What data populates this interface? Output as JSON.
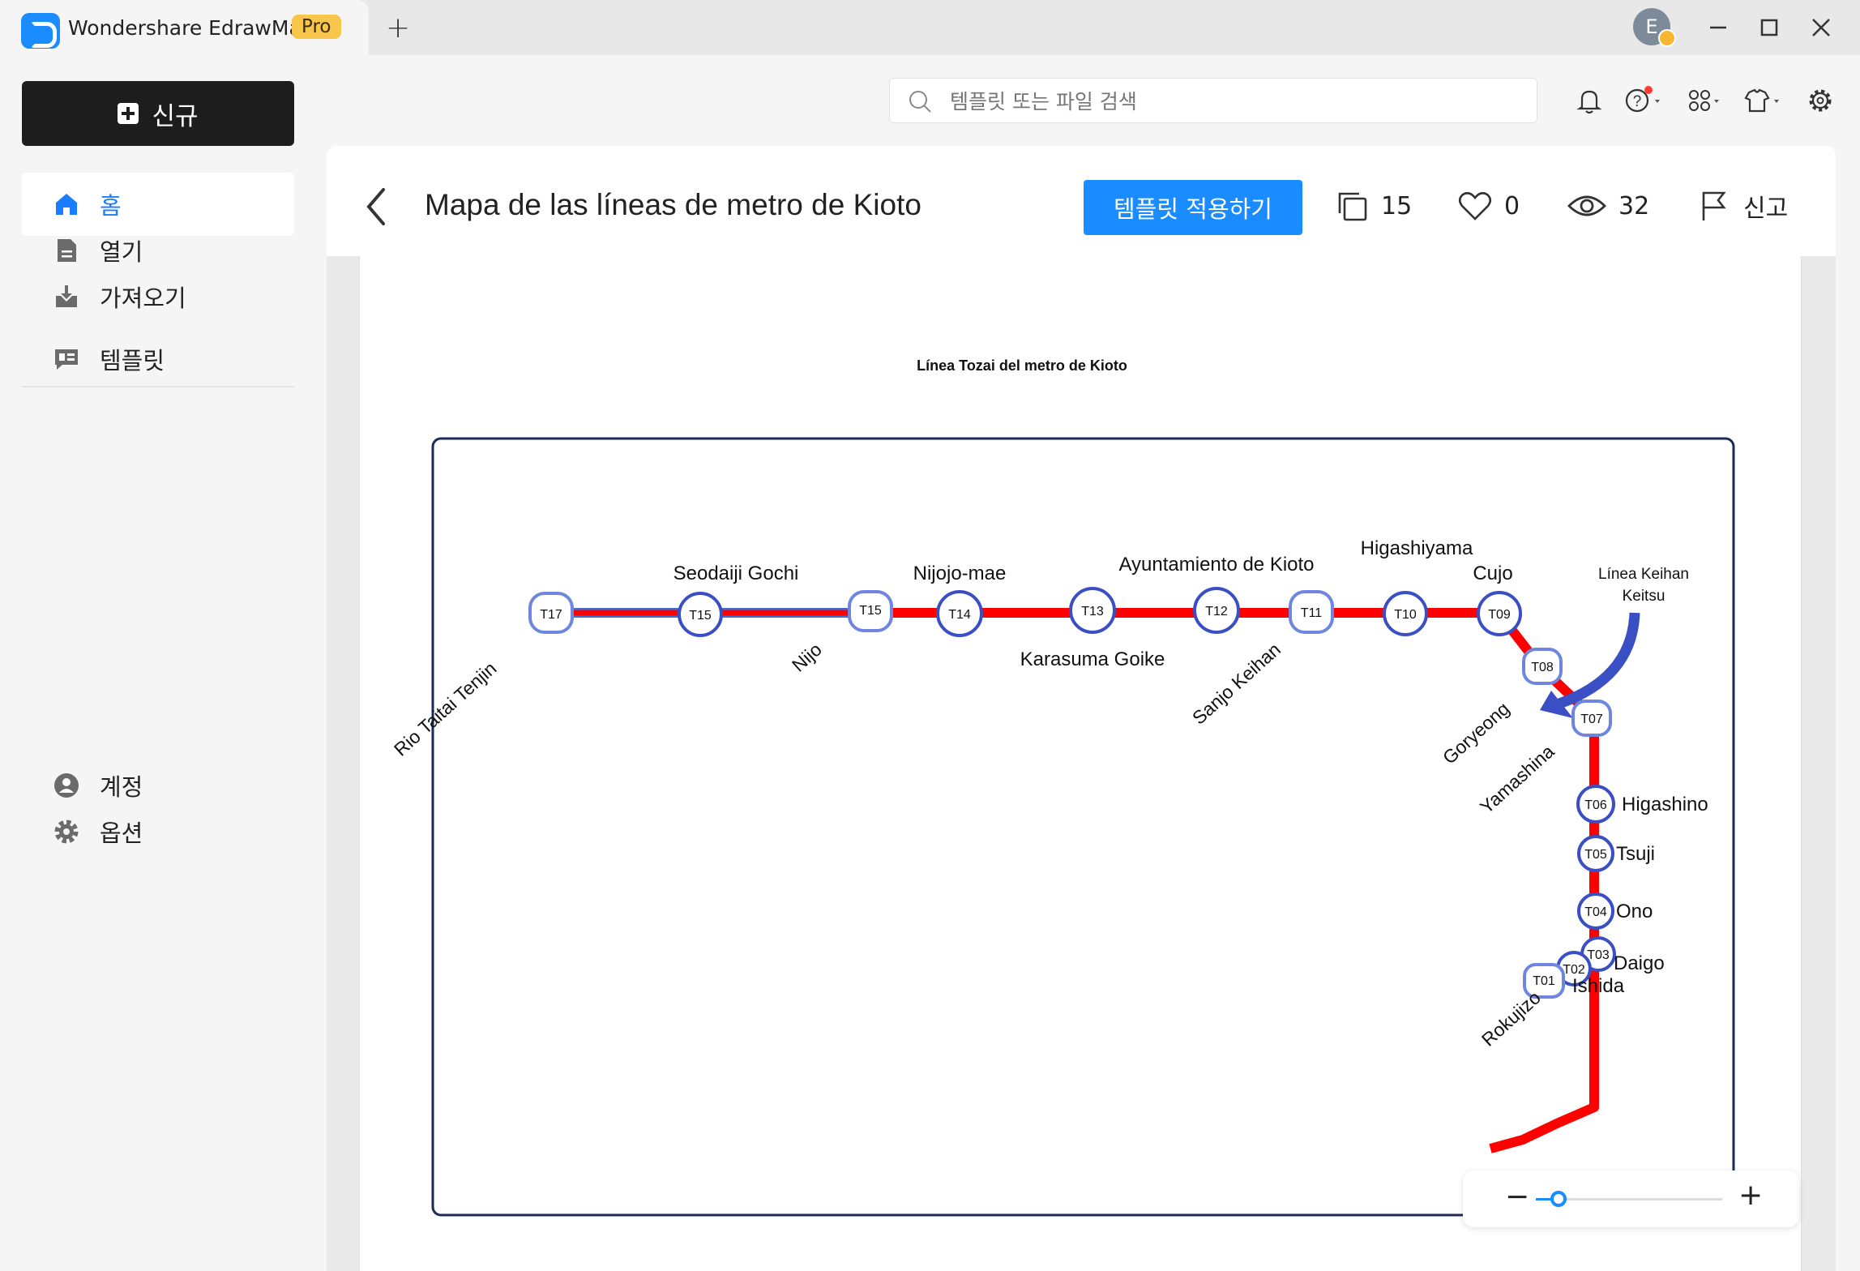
{
  "app": {
    "name": "Wondershare EdrawMax",
    "badge": "Pro",
    "new_tab": "+",
    "user_initial": "E"
  },
  "sidebar": {
    "new_label": "신규",
    "items": [
      {
        "label": "홈",
        "active": true
      },
      {
        "label": "열기"
      },
      {
        "label": "가져오기"
      },
      {
        "label": "템플릿"
      }
    ],
    "bottom": [
      {
        "label": "계정"
      },
      {
        "label": "옵션"
      }
    ]
  },
  "search": {
    "placeholder": "템플릿 또는 파일 검색"
  },
  "template": {
    "title": "Mapa de las líneas de metro de Kioto",
    "apply_label": "템플릿 적용하기",
    "copies": "15",
    "likes": "0",
    "views": "32",
    "report_label": "신고"
  },
  "diagram": {
    "title": "Línea Tozai del metro de Kioto",
    "line_color": "#ff0000",
    "station_stroke": "#3a4fc4",
    "stations": [
      {
        "code": "T17",
        "name": "Rio Taitai Tenjin"
      },
      {
        "code": "T15",
        "name": "Seodaiji Gochi"
      },
      {
        "code": "T15",
        "name": "Nijo"
      },
      {
        "code": "T14",
        "name": "Nijojo-mae"
      },
      {
        "code": "T13",
        "name": "Karasuma Goike"
      },
      {
        "code": "T12",
        "name": "Ayuntamiento de Kioto"
      },
      {
        "code": "T11",
        "name": "Sanjo Keihan"
      },
      {
        "code": "T10",
        "name": "Higashiyama"
      },
      {
        "code": "T09",
        "name": "Cujo"
      },
      {
        "code": "T08",
        "name": "Goryeong"
      },
      {
        "code": "T07",
        "name": "Yamashina"
      },
      {
        "code": "T06",
        "name": "Higashino"
      },
      {
        "code": "T05",
        "name": "Tsuji"
      },
      {
        "code": "T04",
        "name": "Ono"
      },
      {
        "code": "T03",
        "name": "Daigo"
      },
      {
        "code": "T02",
        "name": "Ishida"
      },
      {
        "code": "T01",
        "name": "Rokujizo"
      }
    ],
    "transfer_label_1": "Línea Keihan",
    "transfer_label_2": "Keitsu"
  },
  "zoom": {
    "minus": "−",
    "plus": "+",
    "level": 0.08
  }
}
